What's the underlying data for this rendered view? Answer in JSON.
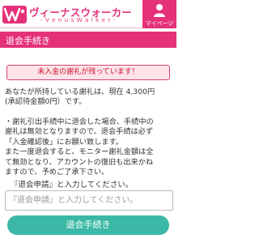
{
  "header": {
    "logo_text": "ヴィーナスウォーカー",
    "logo_sub": "- V e n u s W a l k e r -",
    "mypage_label": "マイページ"
  },
  "page": {
    "title": "退会手続き"
  },
  "alert": {
    "text": "未入金の謝礼が残っています！"
  },
  "content": {
    "p1_line1": "あなたが所持している謝礼は、現在 4,300円",
    "p1_line2": "(承認待金額0円）です。",
    "p2_line1": "・謝礼引出手続中に退会した場合、手続中の",
    "p2_line2": "謝礼は無効となりますので、退会手続は必ず",
    "p2_line3": "「入金確認後」にお願い致します。",
    "p2_line4": "また一度退会すると、モニター謝礼金額は全",
    "p2_line5": "て無効となり、アカウントの復旧も出来かね",
    "p2_line6": "ますので、予めご了承下さい。"
  },
  "form": {
    "prompt": "『退会申請』と入力してください。",
    "placeholder": "『退会申請』と入力してください。",
    "value": "",
    "submit_label": "退会手続き"
  },
  "colors": {
    "brand": "#e5317a",
    "alert_bg": "#fde4e8",
    "alert_text": "#d01030",
    "button": "#3cb9a6"
  },
  "icons": {
    "logo": "venus-walker-logo-icon",
    "mypage": "user-icon"
  }
}
